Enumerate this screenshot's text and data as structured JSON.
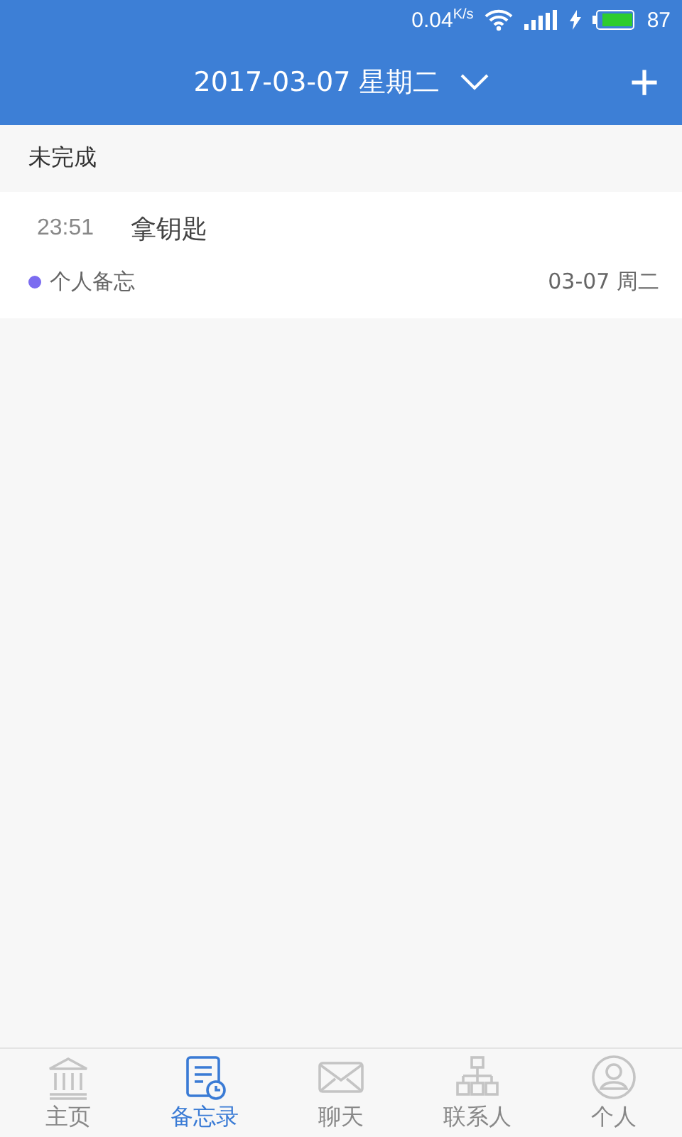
{
  "status_bar": {
    "speed": "0.04",
    "speed_unit": "K/s",
    "battery": "87"
  },
  "header": {
    "date": "2017-03-07 星期二",
    "add": "+"
  },
  "section": {
    "title": "未完成"
  },
  "memos": [
    {
      "time": "23:51",
      "title": "拿钥匙",
      "category": "个人备忘",
      "color": "#7b6cf0",
      "date": "03-07 周二"
    }
  ],
  "tabs": [
    {
      "kind": "home",
      "label": "主页",
      "selected": false
    },
    {
      "kind": "memo",
      "label": "备忘录",
      "selected": true
    },
    {
      "kind": "chat",
      "label": "聊天",
      "selected": false
    },
    {
      "kind": "contacts",
      "label": "联系人",
      "selected": false
    },
    {
      "kind": "profile",
      "label": "个人",
      "selected": false
    }
  ]
}
